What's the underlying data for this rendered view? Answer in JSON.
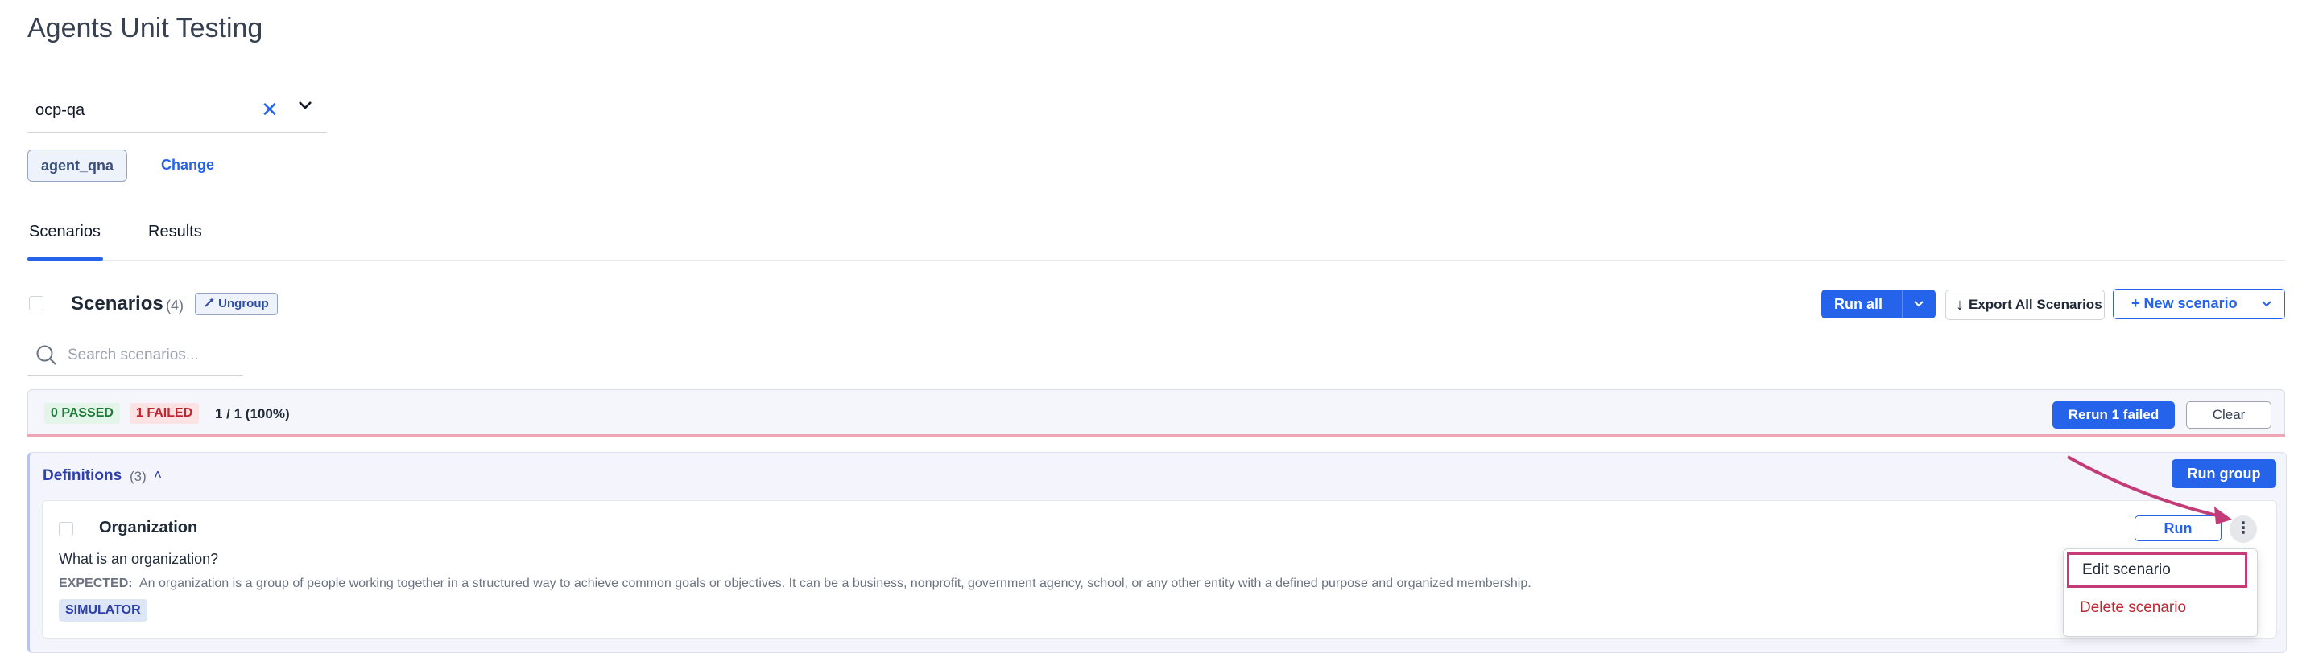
{
  "page": {
    "title": "Agents Unit Testing"
  },
  "project_select": {
    "value": "ocp-qa",
    "clear_glyph": "✕"
  },
  "agent": {
    "name": "agent_qna",
    "change_label": "Change"
  },
  "tabs": [
    {
      "label": "Scenarios",
      "active": true
    },
    {
      "label": "Results",
      "active": false
    }
  ],
  "scenarios_header": {
    "title": "Scenarios",
    "count": "(4)",
    "ungroup_label": "Ungroup",
    "run_all_label": "Run all",
    "export_label": "Export All Scenarios",
    "export_glyph": "↓",
    "new_scenario_label": "+ New scenario"
  },
  "search": {
    "placeholder": "Search scenarios..."
  },
  "summary": {
    "passed_label": "0 PASSED",
    "failed_label": "1 FAILED",
    "ratio": "1 / 1 (100%)",
    "rerun_label": "Rerun 1 failed",
    "clear_label": "Clear"
  },
  "group": {
    "title": "Definitions",
    "count": "(3)",
    "caret": "˄",
    "run_group_label": "Run group"
  },
  "scenario": {
    "title": "Organization",
    "question": "What is an organization?",
    "expected_label": "EXPECTED:",
    "expected_text": "An organization is a group of people working together in a structured way to achieve common goals or objectives. It can be a business, nonprofit, government agency, school, or any other entity with a defined purpose and organized membership.",
    "tag": "SIMULATOR",
    "run_label": "Run",
    "more_glyph": "⋮"
  },
  "context_menu": {
    "edit_label": "Edit scenario",
    "delete_label": "Delete scenario"
  },
  "colors": {
    "primary": "#2563eb",
    "danger": "#c0262f",
    "success": "#1f7a3a",
    "annotation": "#c43c77"
  }
}
